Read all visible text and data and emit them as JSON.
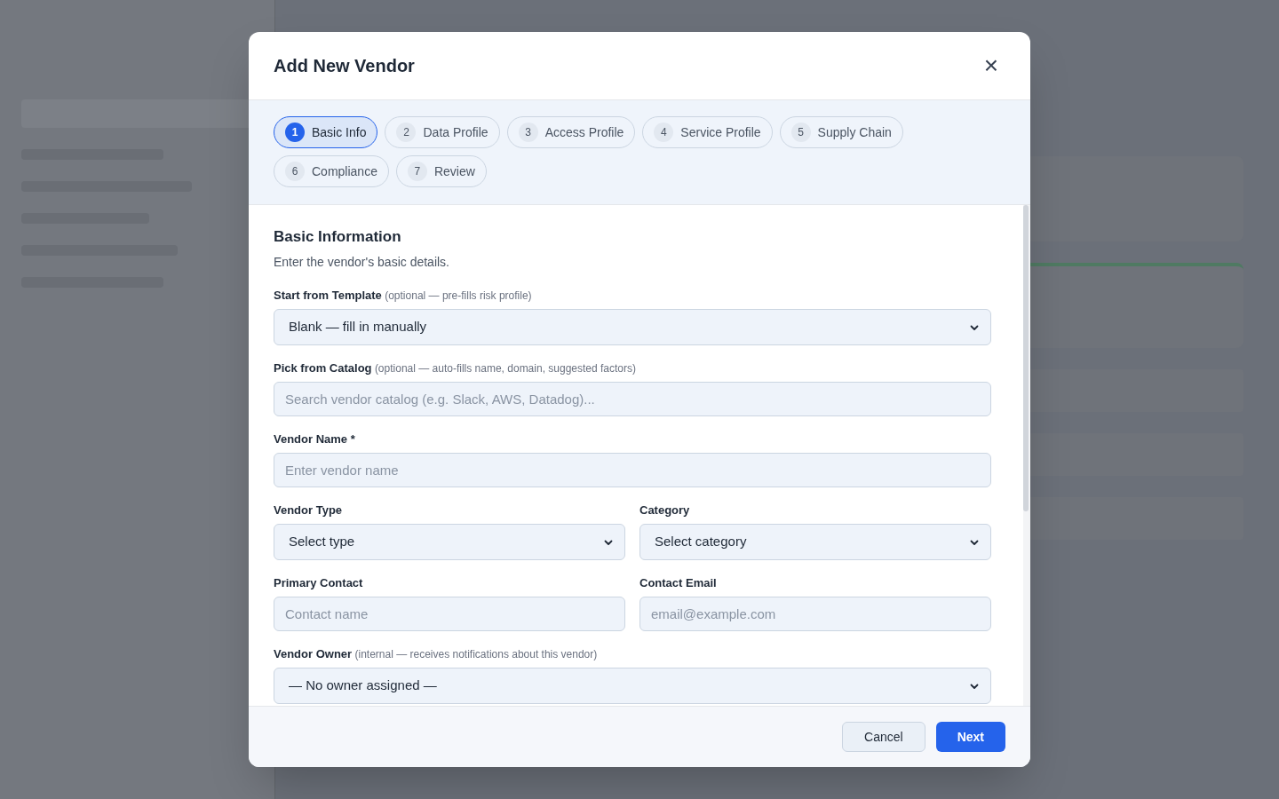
{
  "dialog": {
    "title": "Add New Vendor",
    "close": "×"
  },
  "steps": [
    {
      "number": "1",
      "label": "Basic Info",
      "selected": true
    },
    {
      "number": "2",
      "label": "Data Profile",
      "selected": false
    },
    {
      "number": "3",
      "label": "Access Profile",
      "selected": false
    },
    {
      "number": "4",
      "label": "Service Profile",
      "selected": false
    },
    {
      "number": "5",
      "label": "Supply Chain",
      "selected": false
    },
    {
      "number": "6",
      "label": "Compliance",
      "selected": false
    },
    {
      "number": "7",
      "label": "Review",
      "selected": false
    }
  ],
  "section": {
    "title": "Basic Information",
    "description": "Enter the vendor's basic details."
  },
  "rows": [
    [
      {
        "kind": "select",
        "label": "Start from Template",
        "hint": "(optional — pre-fills risk profile)",
        "value": "Blank — fill in manually"
      }
    ],
    [
      {
        "kind": "input",
        "label": "Pick from Catalog",
        "hint": "(optional — auto-fills name, domain, suggested factors)",
        "placeholder": "Search vendor catalog (e.g. Slack, AWS, Datadog)..."
      }
    ],
    [
      {
        "kind": "input",
        "label": "Vendor Name *",
        "placeholder": "Enter vendor name"
      }
    ],
    [
      {
        "kind": "select",
        "label": "Vendor Type",
        "value": "Select type"
      },
      {
        "kind": "select",
        "label": "Category",
        "value": "Select category"
      }
    ],
    [
      {
        "kind": "input",
        "label": "Primary Contact",
        "placeholder": "Contact name"
      },
      {
        "kind": "input",
        "label": "Contact Email",
        "placeholder": "email@example.com"
      }
    ],
    [
      {
        "kind": "select",
        "label": "Vendor Owner",
        "hint": "(internal — receives notifications about this vendor)",
        "value": "— No owner assigned —"
      }
    ]
  ],
  "buttons": [
    {
      "kind": "secondary",
      "label": "Cancel"
    },
    {
      "kind": "primary",
      "label": "Next"
    }
  ]
}
